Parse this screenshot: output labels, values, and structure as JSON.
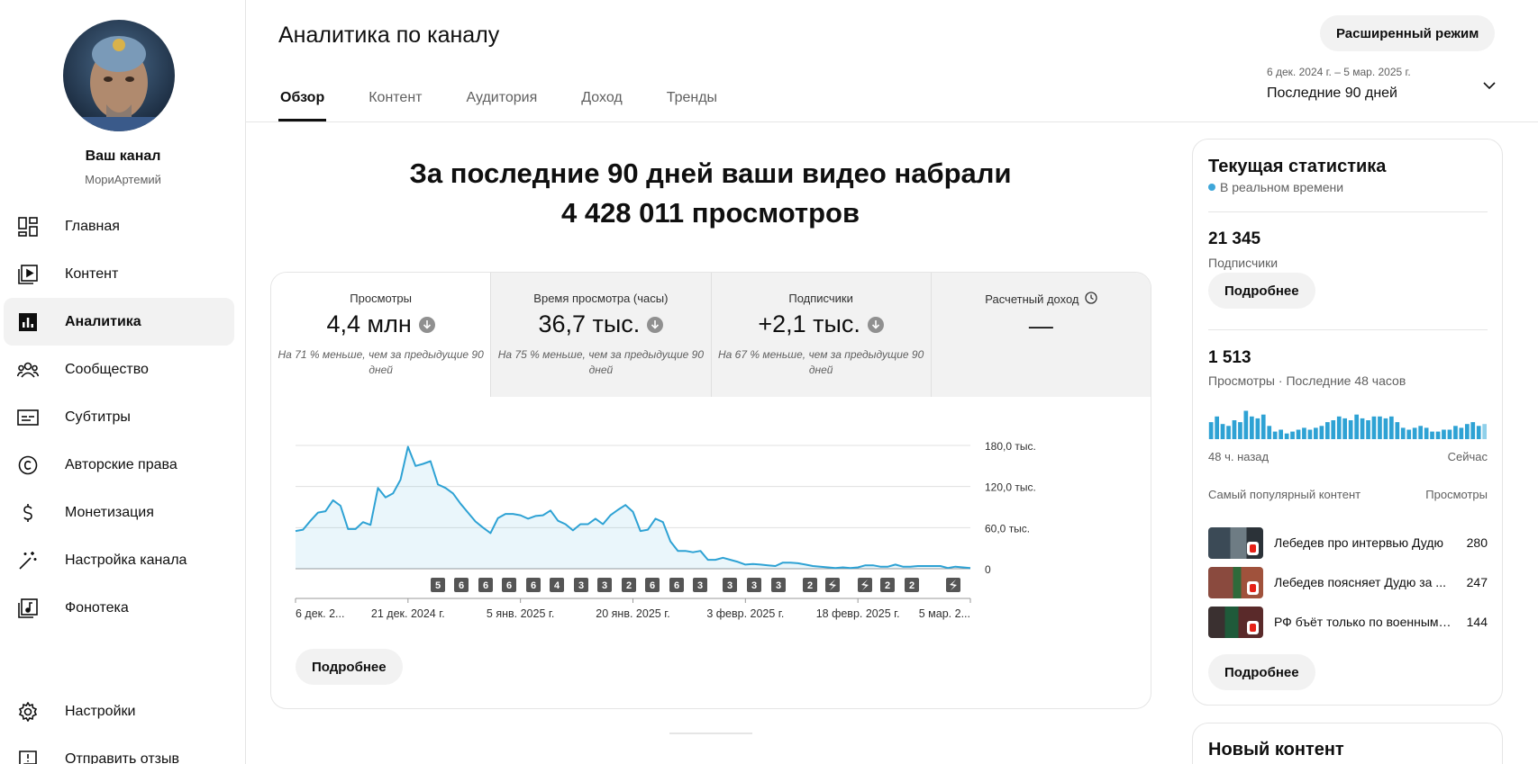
{
  "channel": {
    "title": "Ваш канал",
    "handle": "МориАртемий"
  },
  "sidebar": {
    "items": [
      {
        "label": "Главная",
        "icon": "dashboard-icon"
      },
      {
        "label": "Контент",
        "icon": "content-icon"
      },
      {
        "label": "Аналитика",
        "icon": "analytics-icon",
        "active": true
      },
      {
        "label": "Сообщество",
        "icon": "community-icon"
      },
      {
        "label": "Субтитры",
        "icon": "subtitles-icon"
      },
      {
        "label": "Авторские права",
        "icon": "copyright-icon"
      },
      {
        "label": "Монетизация",
        "icon": "dollar-icon"
      },
      {
        "label": "Настройка канала",
        "icon": "magic-wand-icon"
      },
      {
        "label": "Фонотека",
        "icon": "audio-library-icon"
      }
    ],
    "bottom": [
      {
        "label": "Настройки",
        "icon": "gear-icon"
      },
      {
        "label": "Отправить отзыв",
        "icon": "feedback-icon"
      }
    ]
  },
  "header": {
    "title": "Аналитика по каналу",
    "advanced_mode": "Расширенный режим",
    "tabs": [
      "Обзор",
      "Контент",
      "Аудитория",
      "Доход",
      "Тренды"
    ],
    "active_tab": "Обзор",
    "date_range": "6 дек. 2024 г. – 5 мар. 2025 г.",
    "period": "Последние 90 дней"
  },
  "headline": {
    "line1": "За последние 90 дней ваши видео набрали",
    "line2": "4 428 011 просмотров"
  },
  "metrics": [
    {
      "label": "Просмотры",
      "value": "4,4 млн",
      "note": "На 71 % меньше, чем за предыдущие 90 дней"
    },
    {
      "label": "Время просмотра (часы)",
      "value": "36,7 тыс.",
      "note": "На 75 % меньше, чем за предыдущие 90 дней"
    },
    {
      "label": "Подписчики",
      "value": "+2,1 тыс.",
      "note": "На 67 % меньше, чем за предыдущие 90 дней"
    },
    {
      "label": "Расчетный доход",
      "value": "—",
      "note": ""
    }
  ],
  "overview_more": "Подробнее",
  "chart_data": {
    "type": "area",
    "series": [
      {
        "values": [
          55000,
          57000,
          70000,
          82000,
          84000,
          100000,
          92000,
          58000,
          58000,
          68000,
          64000,
          118000,
          104000,
          110000,
          130000,
          178000,
          150000,
          153000,
          157000,
          123000,
          118000,
          110000,
          95000,
          82000,
          69000,
          60000,
          52000,
          74000,
          80000,
          80000,
          78000,
          73000,
          77000,
          78000,
          85000,
          70000,
          65000,
          56000,
          65000,
          65000,
          73000,
          65000,
          78000,
          86000,
          93000,
          83000,
          55000,
          57000,
          73000,
          68000,
          40000,
          26000,
          26000,
          24000,
          26000,
          13000,
          13000,
          16000,
          13000,
          10000,
          6000,
          7000,
          6000,
          5000,
          4000,
          9000,
          9000,
          8000,
          6000,
          4000,
          3000,
          2000,
          1000,
          2000,
          1000,
          2000,
          5000,
          5000,
          3000,
          3000,
          6000,
          3000,
          3000,
          4000,
          4000,
          4000,
          4000,
          1000,
          3000,
          2000,
          1000
        ]
      }
    ],
    "y_ticks": [
      "180,0 тыс.",
      "120,0 тыс.",
      "60,0 тыс.",
      "0"
    ],
    "ylim": [
      0,
      180000
    ],
    "x_labels": [
      "6 дек. 2...",
      "21 дек. 2024 г.",
      "5 янв. 2025 г.",
      "20 янв. 2025 г.",
      "3 февр. 2025 г.",
      "18 февр. 2025 г.",
      "5 мар. 2..."
    ],
    "upload_markers": [
      "5",
      "6",
      "6",
      "6",
      "6",
      "4",
      "3",
      "3",
      "2",
      "6",
      "6",
      "3",
      "3",
      "3",
      "3",
      "2",
      "shorts",
      "shorts",
      "2",
      "2",
      "shorts"
    ],
    "grid": true,
    "color": "#2ea2d4"
  },
  "realtime": {
    "title": "Текущая статистика",
    "live": "В реальном времени",
    "subscribers": "21 345",
    "subscribers_label": "Подписчики",
    "more1": "Подробнее",
    "views": "1 513",
    "views_label": "Просмотры · Последние 48 часов",
    "bars": [
      0.45,
      0.6,
      0.4,
      0.35,
      0.5,
      0.45,
      0.75,
      0.6,
      0.55,
      0.65,
      0.35,
      0.2,
      0.25,
      0.15,
      0.2,
      0.25,
      0.3,
      0.25,
      0.3,
      0.35,
      0.45,
      0.5,
      0.6,
      0.55,
      0.5,
      0.65,
      0.55,
      0.5,
      0.6,
      0.6,
      0.55,
      0.6,
      0.45,
      0.3,
      0.25,
      0.3,
      0.35,
      0.3,
      0.2,
      0.2,
      0.25,
      0.25,
      0.35,
      0.3,
      0.4,
      0.45,
      0.35,
      0.4
    ],
    "start_label": "48 ч. назад",
    "end_label": "Сейчас",
    "top_content_label": "Самый популярный контент",
    "top_views_label": "Просмотры",
    "videos": [
      {
        "title": "Лебедев про интервью Дудю",
        "views": "280"
      },
      {
        "title": "Лебедев поясняет Дудю за ...",
        "views": "247"
      },
      {
        "title": "РФ бъёт только по военным объектам",
        "views": "144"
      }
    ],
    "more2": "Подробнее"
  },
  "new_content": {
    "title": "Новый контент"
  }
}
